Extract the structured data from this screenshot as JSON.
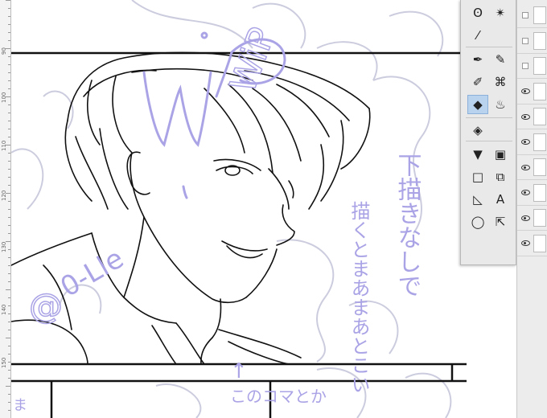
{
  "ruler": {
    "labels": [
      "90",
      "100",
      "110",
      "120",
      "130",
      "140",
      "150"
    ]
  },
  "canvas": {
    "annotations": {
      "wip": "WiP",
      "at_sign": "@",
      "username_tail": "0-Lle",
      "note_line1": "下描きなしで",
      "note_line2": "描くとまあまあとこい",
      "note_line3": "このコマとか",
      "arrow": "↑",
      "corner_char": "ま"
    }
  },
  "tool_palette": {
    "tools": [
      {
        "name": "lasso-select-icon",
        "glyph": "ʘ",
        "active": false
      },
      {
        "name": "magic-wand-icon",
        "glyph": "✴",
        "active": false
      },
      {
        "name": "eyedropper-icon",
        "glyph": "⁄",
        "active": false
      },
      {
        "name": "pen-icon",
        "glyph": "✒",
        "active": false
      },
      {
        "name": "pencil-icon",
        "glyph": "✎",
        "active": false
      },
      {
        "name": "brush-icon",
        "glyph": "✐",
        "active": false
      },
      {
        "name": "decoration-icon",
        "glyph": "⌘",
        "active": false
      },
      {
        "name": "eraser-icon",
        "glyph": "◆",
        "active": true
      },
      {
        "name": "blend-icon",
        "glyph": "♨",
        "active": false
      },
      {
        "name": "fill-bucket-icon",
        "glyph": "◈",
        "active": false
      },
      {
        "name": "fill-icon",
        "glyph": "▼",
        "active": false
      },
      {
        "name": "gradient-icon",
        "glyph": "▣",
        "active": false
      },
      {
        "name": "figure-icon",
        "glyph": "□",
        "active": false
      },
      {
        "name": "frame-border-icon",
        "glyph": "⧉",
        "active": false
      },
      {
        "name": "ruler-icon",
        "glyph": "◺",
        "active": false
      },
      {
        "name": "text-icon",
        "glyph": "A",
        "active": false
      },
      {
        "name": "balloon-icon",
        "glyph": "◯",
        "active": false
      },
      {
        "name": "correct-line-icon",
        "glyph": "⇱",
        "active": false
      }
    ]
  },
  "layers": [
    {
      "visible": false
    },
    {
      "visible": false
    },
    {
      "visible": false
    },
    {
      "visible": true
    },
    {
      "visible": true
    },
    {
      "visible": true
    },
    {
      "visible": true
    },
    {
      "visible": true
    },
    {
      "visible": true
    },
    {
      "visible": true
    }
  ]
}
